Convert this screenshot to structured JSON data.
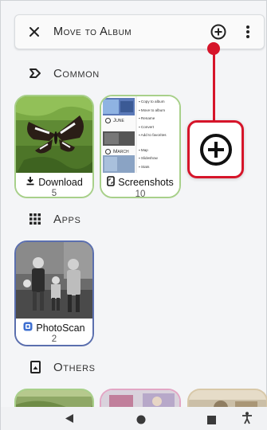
{
  "appbar": {
    "close_icon": "close-icon",
    "title": "Move to Album",
    "add_icon": "add-circle-icon",
    "more_icon": "more-vertical-icon"
  },
  "sections": {
    "common": {
      "label": "Common",
      "icon": "label-tag-icon"
    },
    "apps": {
      "label": "Apps",
      "icon": "grid-icon"
    },
    "others": {
      "label": "Others",
      "icon": "portrait-icon"
    }
  },
  "albums": {
    "download": {
      "name": "Download",
      "count": "5",
      "icon": "download-icon"
    },
    "screenshots": {
      "name": "Screenshots",
      "count": "10",
      "icon": "screenshot-phone-icon",
      "menu_items": [
        "Copy to album",
        "Move to album",
        "Rename",
        "Convert",
        "Add to favorites",
        "Map",
        "Slideshow",
        "Stats"
      ],
      "date_labels": [
        "June",
        "March"
      ]
    },
    "photoscan": {
      "name": "PhotoScan",
      "count": "2",
      "icon": "photoscan-icon"
    }
  },
  "callout": {
    "icon": "add-circle-icon",
    "color": "#d6152a"
  },
  "navbar": {
    "back_icon": "back-triangle-icon",
    "home_icon": "home-circle-icon",
    "recents_icon": "recents-square-icon",
    "accessibility_icon": "accessibility-icon"
  },
  "colors": {
    "download_border": "#a8d08a",
    "screenshots_border": "#a8d08a",
    "photoscan_border": "#5b6fae",
    "accent_red": "#d6152a"
  }
}
